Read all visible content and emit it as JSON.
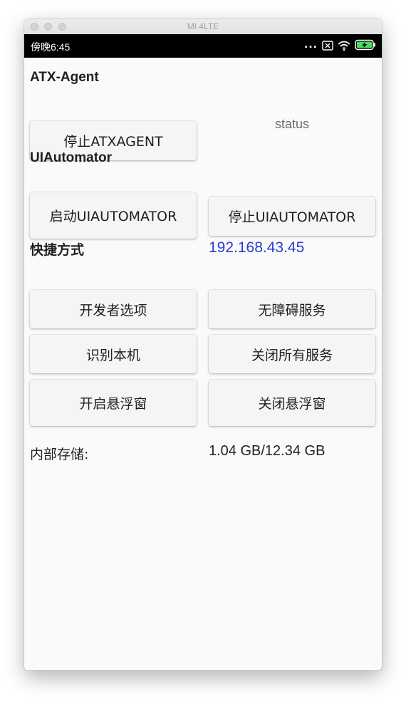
{
  "window": {
    "title": "MI 4LTE"
  },
  "statusbar": {
    "time": "傍晚6:45",
    "more": "...",
    "battery_color": "#4cd964"
  },
  "atx": {
    "title": "ATX-Agent",
    "stop_button": "停止ATXAGENT",
    "status": "status"
  },
  "uiautomator": {
    "title": "UIAutomator",
    "start_button": "启动UIAUTOMATOR",
    "stop_button": "停止UIAUTOMATOR"
  },
  "shortcuts": {
    "title": "快捷方式",
    "ip": "192.168.43.45",
    "ip_color": "#2b3ad6",
    "buttons": {
      "developer_options": "开发者选项",
      "accessibility": "无障碍服务",
      "identify": "识别本机",
      "close_all": "关闭所有服务",
      "open_float": "开启悬浮窗",
      "close_float": "关闭悬浮窗"
    }
  },
  "storage": {
    "label": "内部存储:",
    "value": "1.04 GB/12.34 GB"
  }
}
